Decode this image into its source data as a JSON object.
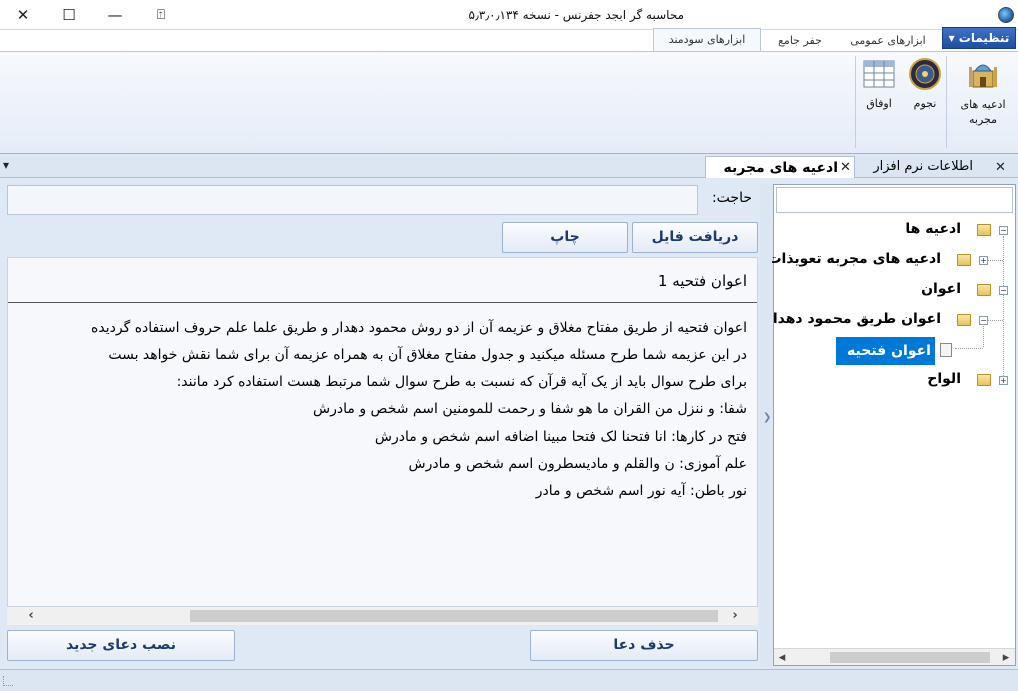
{
  "window": {
    "title": "محاسبه گر ابجد جفرنس - نسخه ۵٫۳٫۰٫۱۳۴",
    "close_glyph": "✕",
    "maximize_glyph": "☐",
    "minimize_glyph": "—",
    "restore_glyph": "⍐"
  },
  "ribbon": {
    "settings_label": "تنظیمات ▾",
    "tabs": [
      {
        "label": "ابزارهای عمومی"
      },
      {
        "label": "جفر جامع"
      },
      {
        "label": "ابزارهای سودمند"
      }
    ],
    "buttons": [
      {
        "label": "ادعیه های مجربه",
        "icon": "mosque-icon"
      },
      {
        "label": "نجوم",
        "icon": "zodiac-icon"
      },
      {
        "label": "اوفاق",
        "icon": "grid-table-icon"
      }
    ]
  },
  "panels": {
    "dropdown_glyph": "▾",
    "close_glyph": "✕",
    "tabs": [
      {
        "label": "اطلاعات نرم افزار"
      },
      {
        "label": "ادعیه های مجربه"
      }
    ]
  },
  "tree": {
    "nodes": [
      {
        "label": "ادعیه ها",
        "expander": "−"
      },
      {
        "label": "ادعیه های مجربه تعویذات",
        "expander": "+"
      },
      {
        "label": "اعوان",
        "expander": "−"
      },
      {
        "label": "اعوان طریق محمود دهدار",
        "expander": "−"
      },
      {
        "label": "اعوان فتحیه 1"
      },
      {
        "label": "الواح",
        "expander": "+"
      }
    ],
    "scroll_left": "◂",
    "scroll_right": "▸"
  },
  "main": {
    "hajat_label": "حاجت:",
    "hajat_value": "",
    "receive_file_label": "دریافت فایل",
    "print_label": "چاپ",
    "content_title": "اعوان فتحیه 1",
    "content_lines": [
      "اعوان فتحیه از طریق مفتاح مغلاق و عزیمه آن از دو روش محمود دهدار و طریق علما علم حروف استفاده گردیده",
      "در این عزیمه شما طرح مسئله میکنید و جدول مفتاح مغلاق آن به همراه عزیمه آن برای شما نقش خواهد بست",
      "برای طرح سوال باید از یک آیه قرآن که نسبت به طرح سوال شما مرتبط هست استفاده کرد مانند:",
      "شفا: و ننزل من القران ما هو شفا و رحمت للمومنین اسم شخص و مادرش",
      "فتح در کارها: انا فتحنا لک فتحا مبینا اضافه اسم شخص و مادرش",
      "علم آموزی: ن والقلم و مادیسطرون اسم شخص و مادرش",
      "نور باطن: آیه نور اسم شخص و مادر"
    ],
    "scroll_left": "‹",
    "scroll_right": "›",
    "delete_label": "حذف دعا",
    "install_label": "نصب دعای جدید"
  }
}
